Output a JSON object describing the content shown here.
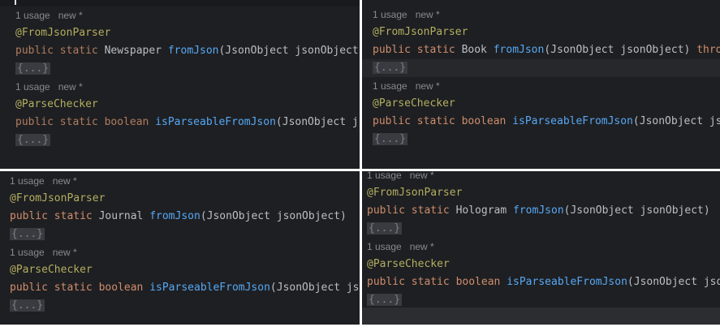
{
  "panels": [
    {
      "usage": "1 usage",
      "new": "new *",
      "ann1": "@FromJsonParser",
      "kw": "public static",
      "type": "Newspaper",
      "method": "fromJson",
      "params": "(JsonObject jsonObject)",
      "fold": "{...}",
      "ann2": "@ParseChecker",
      "kw2": "public static boolean",
      "method2": "isParseableFromJson",
      "params2": "(JsonObject jsonObject)"
    },
    {
      "usage": "1 usage",
      "new": "new *",
      "ann1": "@FromJsonParser",
      "kw": "public static",
      "type": "Book",
      "method": "fromJson",
      "params": "(JsonObject jsonObject)",
      "throws": "throws",
      "fold": "{...}",
      "ann2": "@ParseChecker",
      "kw2": "public static boolean",
      "method2": "isParseableFromJson",
      "params2": "(JsonObject jsonObject)"
    },
    {
      "usage": "1 usage",
      "new": "new *",
      "ann1": "@FromJsonParser",
      "kw": "public static",
      "type": "Journal",
      "method": "fromJson",
      "params": "(JsonObject jsonObject)",
      "fold": "{...}",
      "ann2": "@ParseChecker",
      "kw2": "public static boolean",
      "method2": "isParseableFromJson",
      "params2": "(JsonObject jsonObject)"
    },
    {
      "usage": "1 usage",
      "new": "new *",
      "ann1": "@FromJsonParser",
      "kw": "public static",
      "type": "Hologram",
      "method": "fromJson",
      "params": "(JsonObject jsonObject)",
      "fold": "{...}",
      "ann2": "@ParseChecker",
      "kw2": "public static boolean",
      "method2": "isParseableFromJson",
      "params2": "(JsonObject jsonObject)"
    }
  ]
}
